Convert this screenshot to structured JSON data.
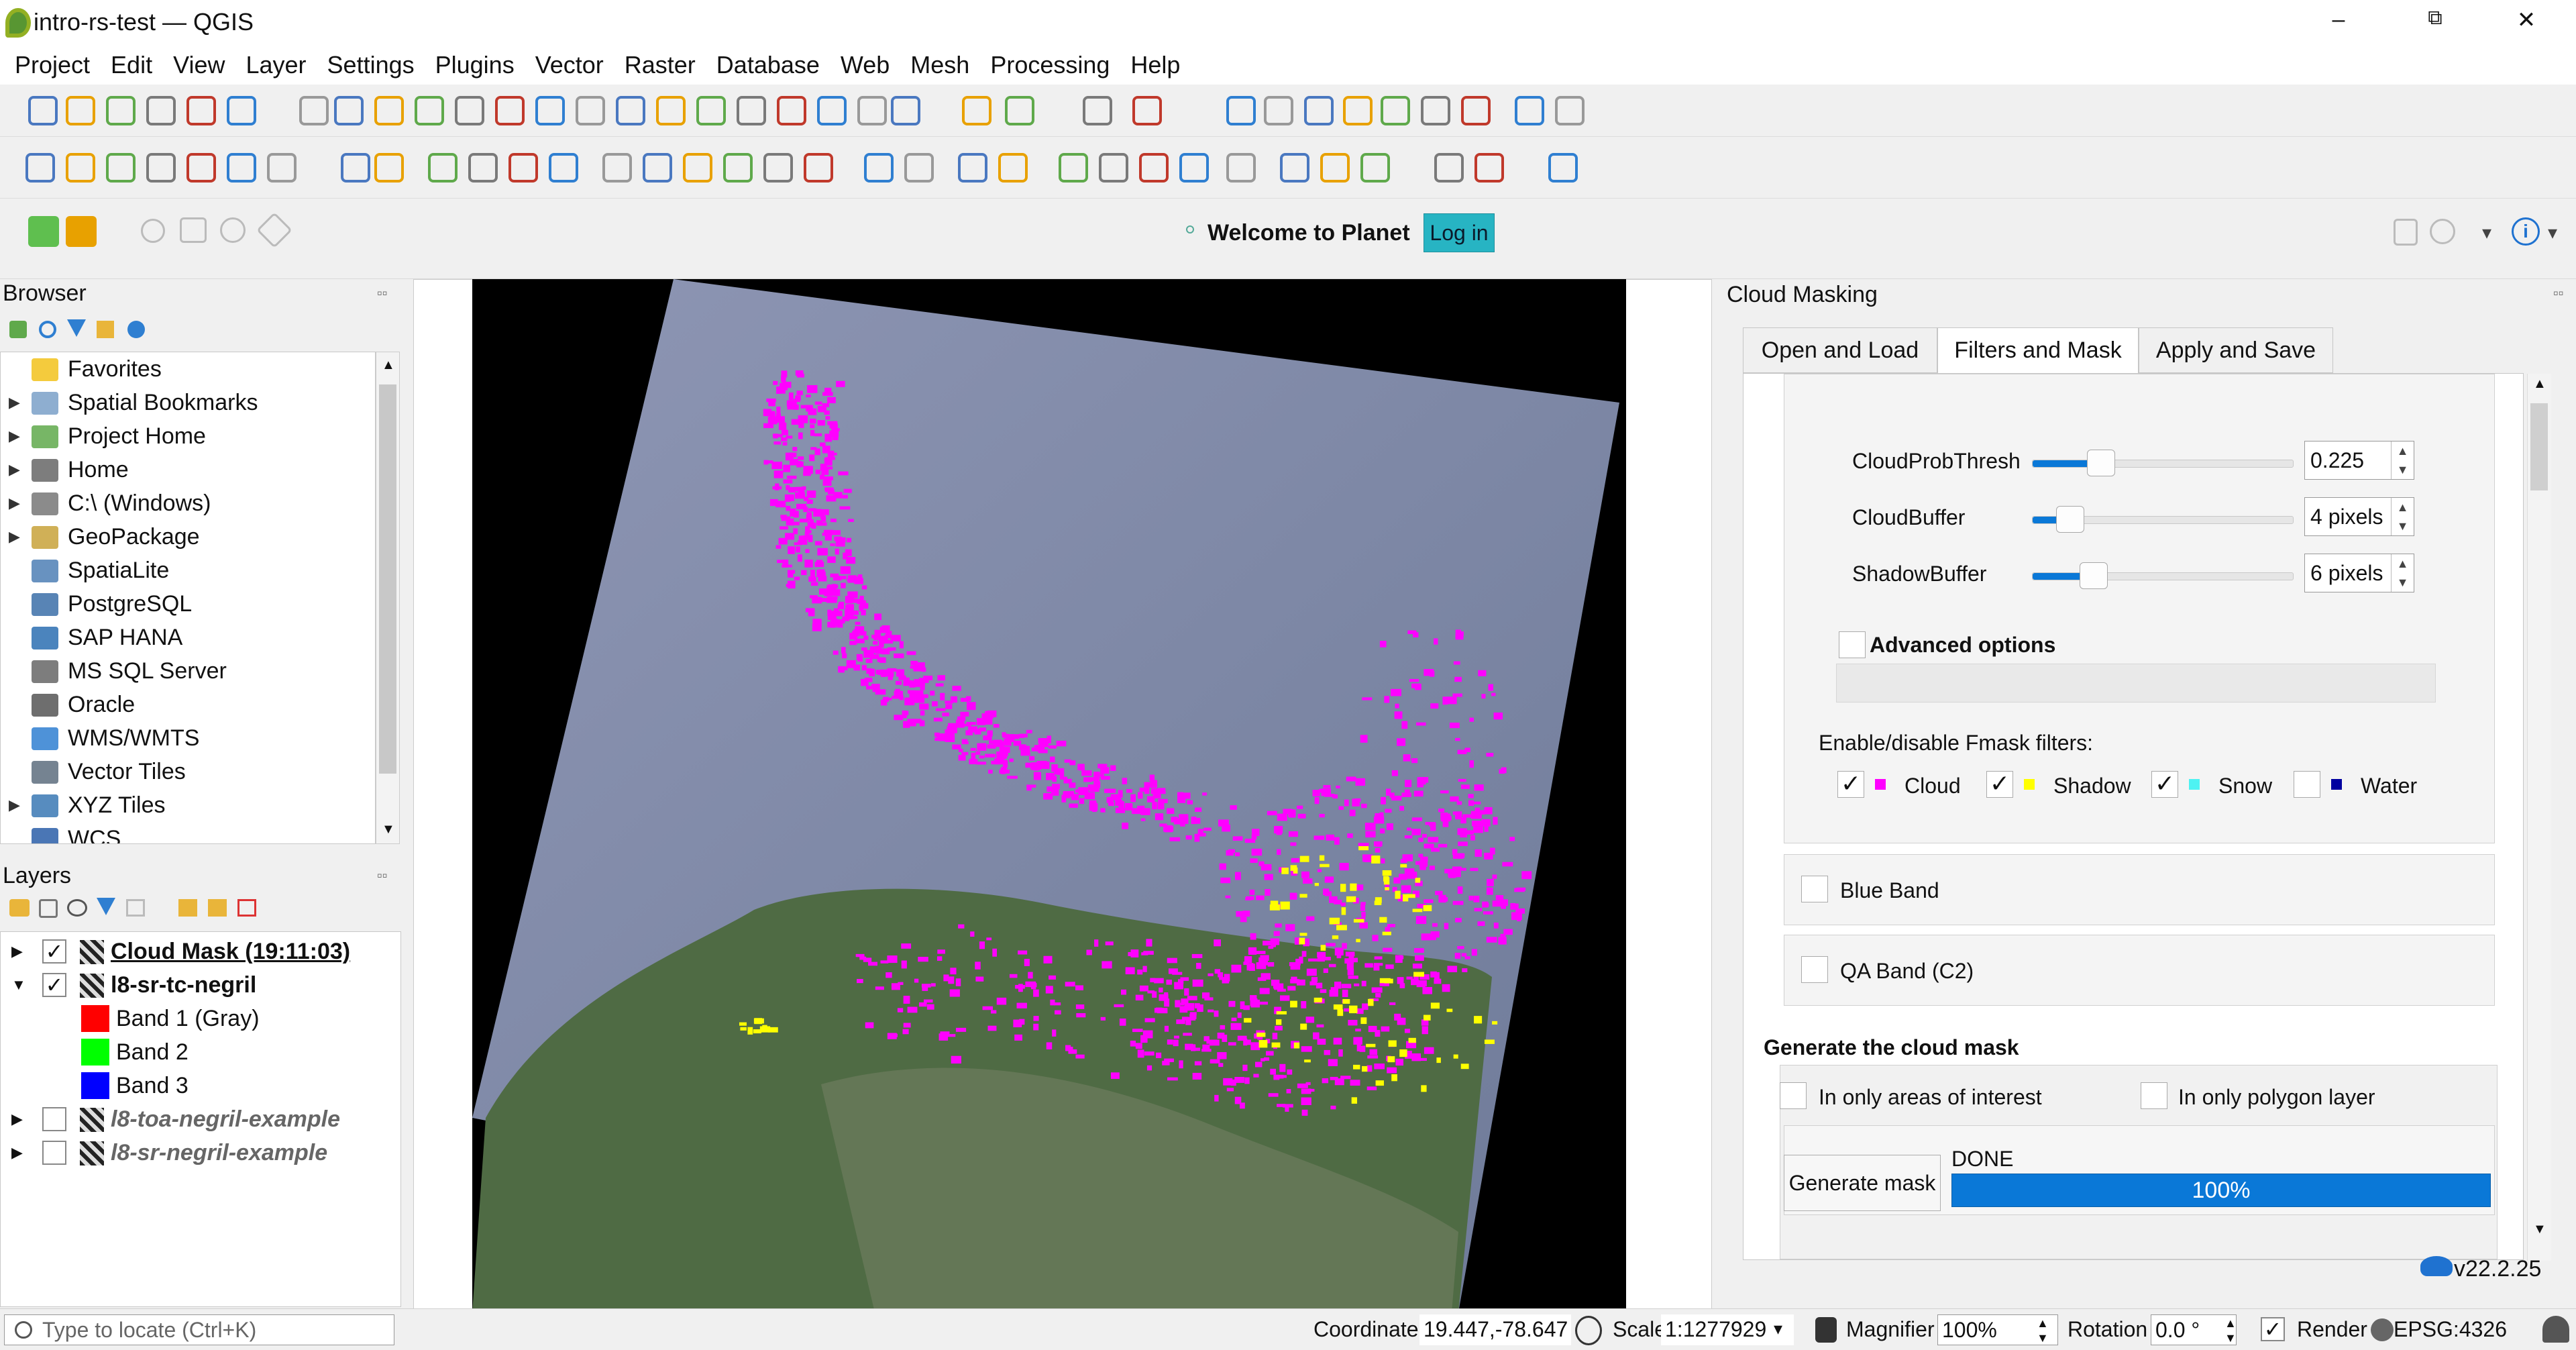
{
  "window": {
    "title": "intro-rs-test — QGIS",
    "minimize": "–",
    "restore": "⧉",
    "close": "✕"
  },
  "menu": [
    "Project",
    "Edit",
    "View",
    "Layer",
    "Settings",
    "Plugins",
    "Vector",
    "Raster",
    "Database",
    "Web",
    "Mesh",
    "Processing",
    "Help"
  ],
  "planet": {
    "welcome": "Welcome to Planet",
    "login": "Log in"
  },
  "browser": {
    "title": "Browser",
    "items": [
      {
        "label": "Favorites",
        "icon": "star-icon",
        "expandable": false
      },
      {
        "label": "Spatial Bookmarks",
        "icon": "bookmark-icon",
        "expandable": true
      },
      {
        "label": "Project Home",
        "icon": "project-home-icon",
        "expandable": true
      },
      {
        "label": "Home",
        "icon": "home-folder-icon",
        "expandable": true
      },
      {
        "label": "C:\\ (Windows)",
        "icon": "drive-icon",
        "expandable": true
      },
      {
        "label": "GeoPackage",
        "icon": "geopackage-icon",
        "expandable": true
      },
      {
        "label": "SpatiaLite",
        "icon": "spatialite-icon",
        "expandable": false
      },
      {
        "label": "PostgreSQL",
        "icon": "postgresql-icon",
        "expandable": false
      },
      {
        "label": "SAP HANA",
        "icon": "sap-hana-icon",
        "expandable": false
      },
      {
        "label": "MS SQL Server",
        "icon": "mssql-icon",
        "expandable": false
      },
      {
        "label": "Oracle",
        "icon": "oracle-icon",
        "expandable": false
      },
      {
        "label": "WMS/WMTS",
        "icon": "globe-icon",
        "expandable": false
      },
      {
        "label": "Vector Tiles",
        "icon": "vector-tiles-icon",
        "expandable": false
      },
      {
        "label": "XYZ Tiles",
        "icon": "xyz-tiles-icon",
        "expandable": true
      },
      {
        "label": "WCS",
        "icon": "wcs-icon",
        "expandable": false
      }
    ]
  },
  "layers": {
    "title": "Layers",
    "items": [
      {
        "label": "Cloud Mask (19:11:03)",
        "checked": true,
        "expanded": false,
        "style": "bold-underline"
      },
      {
        "label": "l8-sr-tc-negril",
        "checked": true,
        "expanded": true,
        "style": "bold"
      },
      {
        "label": "Band 1 (Gray)",
        "swatch": "#ff0000",
        "indent": true
      },
      {
        "label": "Band 2",
        "swatch": "#00ff00",
        "indent": true
      },
      {
        "label": "Band 3",
        "swatch": "#0000ff",
        "indent": true
      },
      {
        "label": "l8-toa-negril-example",
        "checked": false,
        "expanded": false,
        "style": "italic"
      },
      {
        "label": "l8-sr-negril-example",
        "checked": false,
        "expanded": false,
        "style": "italic"
      }
    ]
  },
  "cloudmask": {
    "title": "Cloud Masking",
    "tabs": [
      "Open and Load",
      "Filters and Mask",
      "Apply and Save"
    ],
    "active_tab": 1,
    "params": [
      {
        "label": "CloudProbThresh",
        "value": "0.225",
        "slider_fraction": 0.22
      },
      {
        "label": "CloudBuffer",
        "value": "4 pixels",
        "slider_fraction": 0.1
      },
      {
        "label": "ShadowBuffer",
        "value": "6 pixels",
        "slider_fraction": 0.19
      }
    ],
    "advanced": "Advanced options",
    "filters_label": "Enable/disable Fmask filters:",
    "filters": [
      {
        "label": "Cloud",
        "checked": true,
        "color": "#ff00ff"
      },
      {
        "label": "Shadow",
        "checked": true,
        "color": "#ffff00"
      },
      {
        "label": "Snow",
        "checked": true,
        "color": "#4ef2f2"
      },
      {
        "label": "Water",
        "checked": false,
        "color": "#0000a0"
      }
    ],
    "blue_band": "Blue Band",
    "qa_band": "QA Band (C2)",
    "generate_heading": "Generate the cloud mask",
    "aoi_option": "In only areas of interest",
    "polygon_option": "In only polygon layer",
    "generate_button": "Generate mask",
    "status": "DONE",
    "progress": "100%",
    "progress_value": 1.0,
    "version": "v22.2.25"
  },
  "statusbar": {
    "locate_placeholder": "Type to locate (Ctrl+K)",
    "coordinate_label": "Coordinate",
    "coordinate": "19.447,-78.647",
    "scale_label": "Scale",
    "scale": "1:1277929",
    "magnifier_label": "Magnifier",
    "magnifier": "100%",
    "rotation_label": "Rotation",
    "rotation": "0.0 °",
    "render_label": "Render",
    "crs": "EPSG:4326"
  }
}
